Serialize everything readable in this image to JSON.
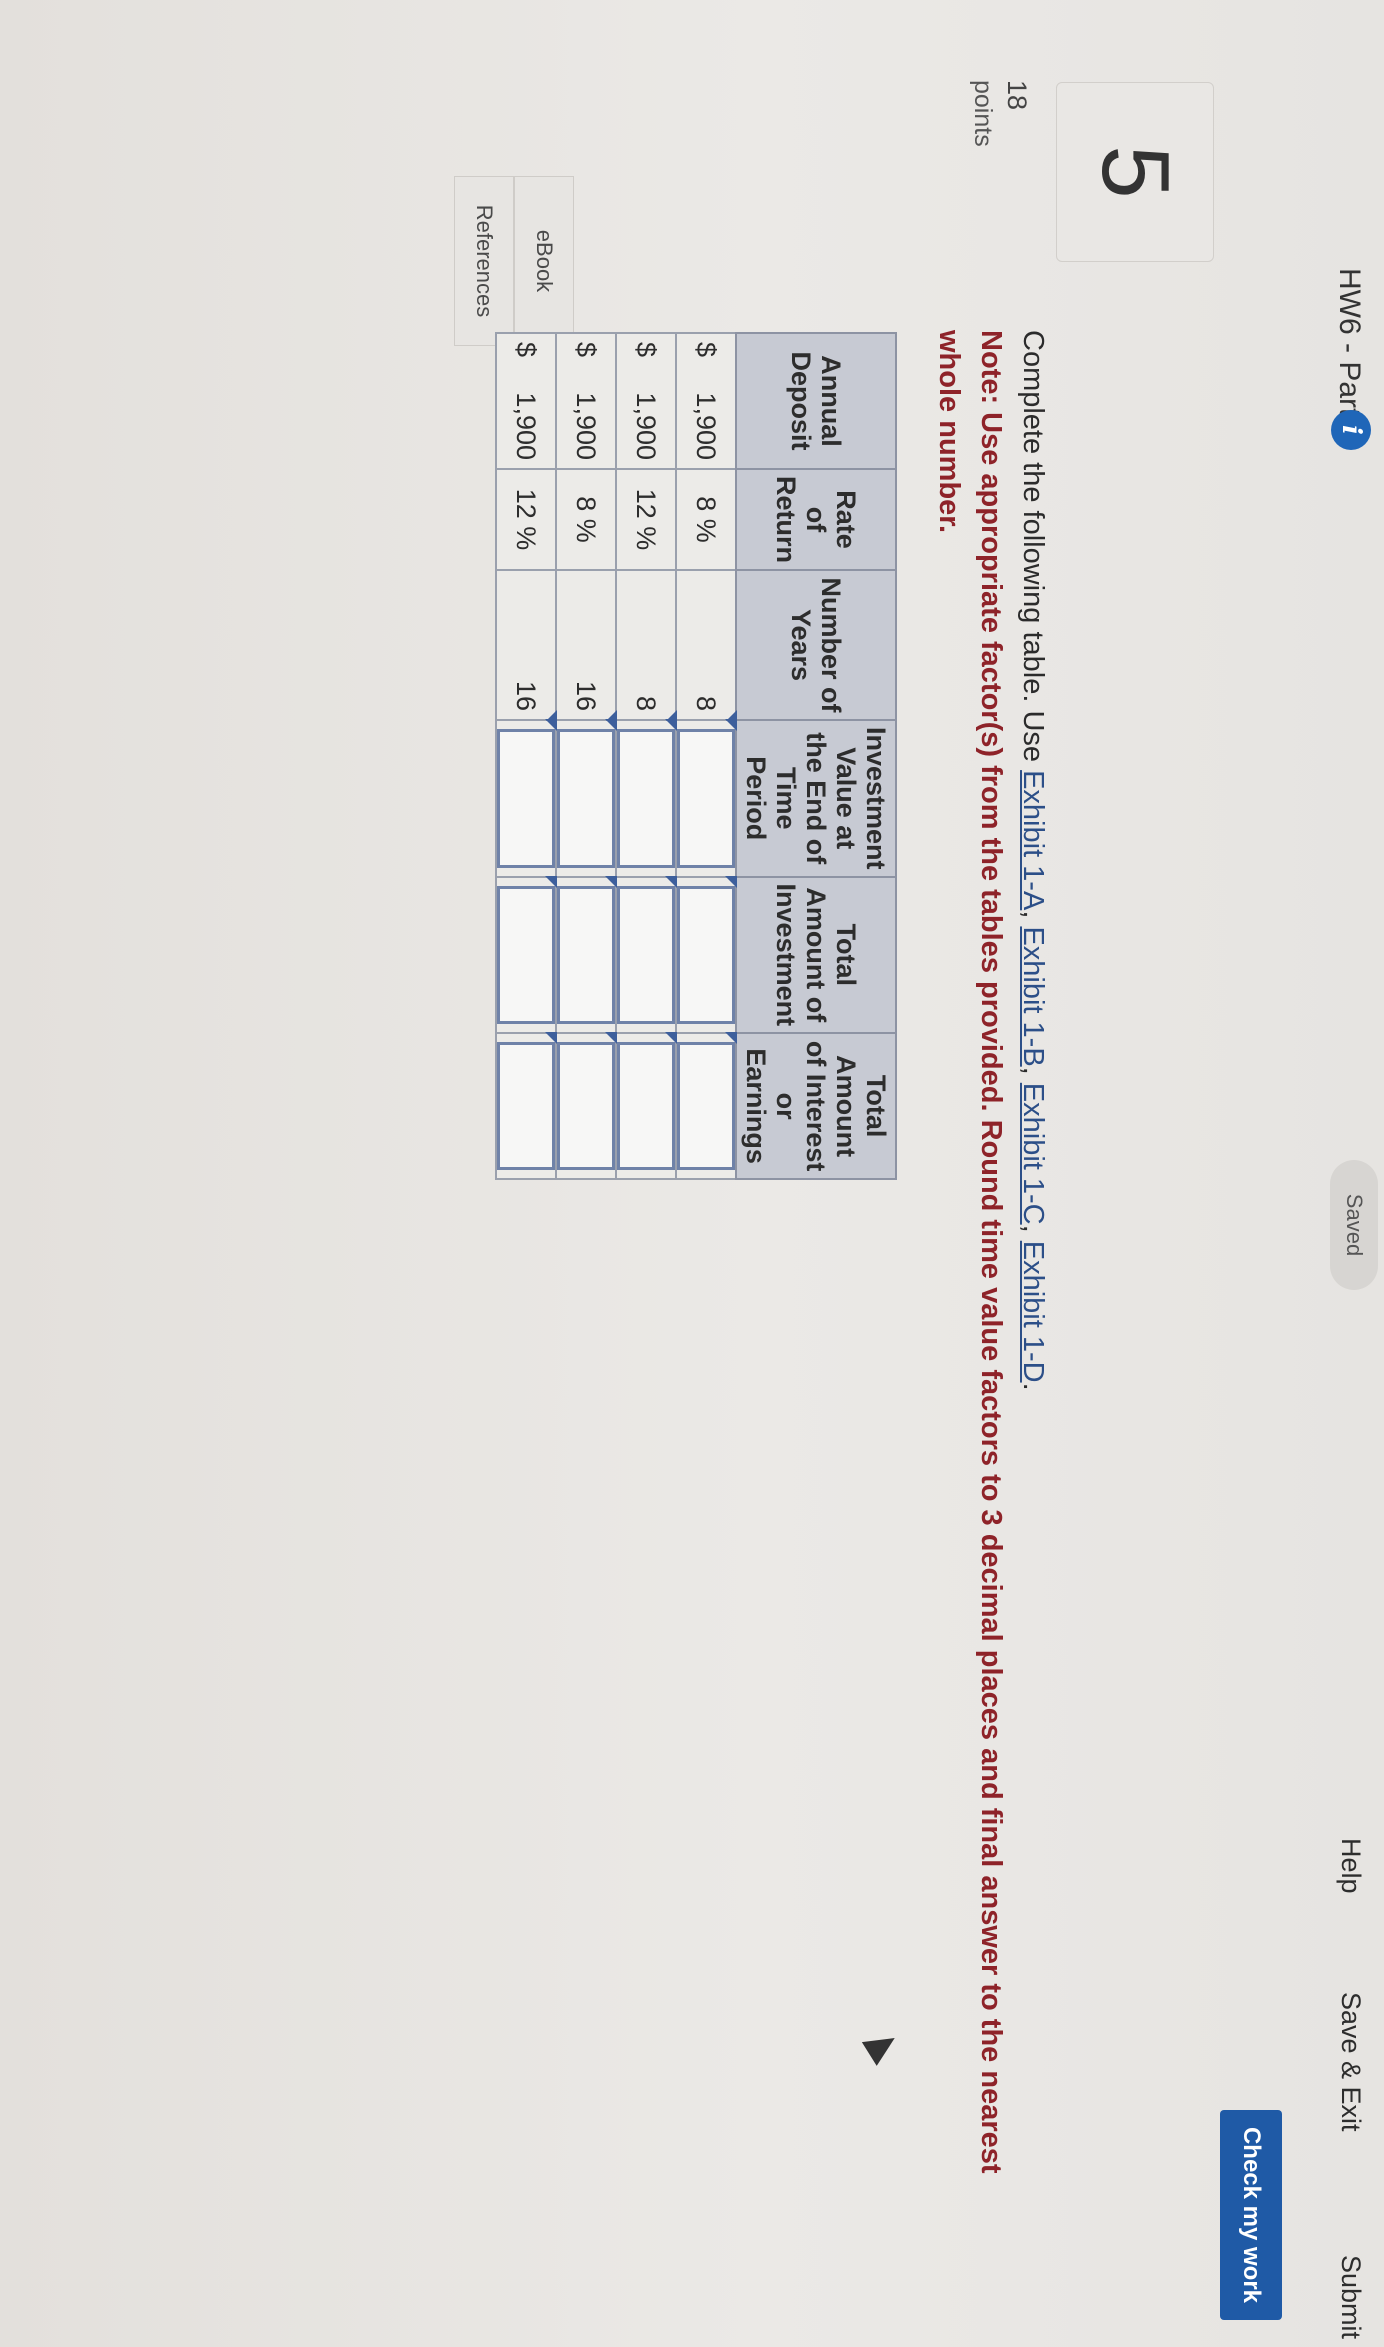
{
  "header": {
    "title": "HW6 - Part I",
    "info_icon": "info-icon",
    "saved_status": "Saved",
    "help": "Help",
    "save_exit": "Save & Exit",
    "submit": "Submit"
  },
  "toolbar": {
    "check_label": "Check my work"
  },
  "question": {
    "number": "5",
    "points_value": "18",
    "points_label": "points",
    "side_buttons": [
      "eBook",
      "References"
    ]
  },
  "instructions": {
    "lead": "Complete the following table. Use ",
    "links": [
      "Exhibit 1-A",
      "Exhibit 1-B",
      "Exhibit 1-C",
      "Exhibit 1-D"
    ],
    "note": "Note: Use appropriate factor(s) from the tables provided. Round time value factors to 3 decimal places and final answer to the nearest whole number."
  },
  "table": {
    "headers": [
      "Annual Deposit",
      "Rate of Return",
      "Number of Years",
      "Investment Value at the End of Time Period",
      "Total Amount of Investment",
      "Total Amount of Interest or Earnings"
    ],
    "rows": [
      {
        "currency": "$",
        "deposit": "1,900",
        "rate": "8 %",
        "years": "8"
      },
      {
        "currency": "$",
        "deposit": "1,900",
        "rate": "12 %",
        "years": "8"
      },
      {
        "currency": "$",
        "deposit": "1,900",
        "rate": "8 %",
        "years": "16"
      },
      {
        "currency": "$",
        "deposit": "1,900",
        "rate": "12 %",
        "years": "16"
      }
    ]
  },
  "colors": {
    "accent": "#1f5aa6",
    "note_text": "#8e2329",
    "link": "#2c4f88",
    "table_header": "#c7cad3"
  }
}
